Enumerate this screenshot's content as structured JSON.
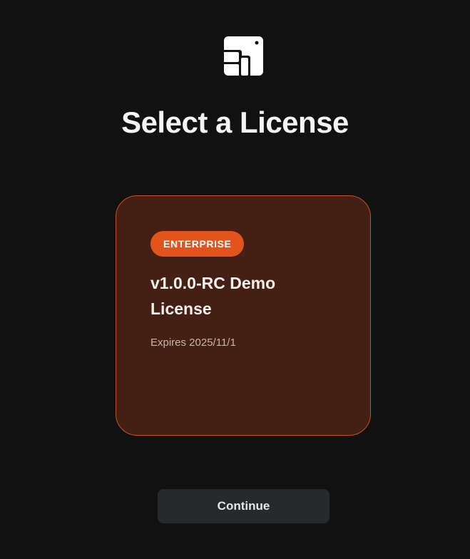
{
  "page": {
    "title": "Select a License"
  },
  "license": {
    "badge": "ENTERPRISE",
    "name": "v1.0.0-RC Demo License",
    "expiry": "Expires 2025/11/1"
  },
  "actions": {
    "continue_label": "Continue"
  },
  "colors": {
    "background": "#111112",
    "card_background": "#442014",
    "card_border": "#c8501e",
    "badge": "#e3541c",
    "button": "#272a2d"
  },
  "icons": {
    "logo": "app-logo-icon"
  }
}
